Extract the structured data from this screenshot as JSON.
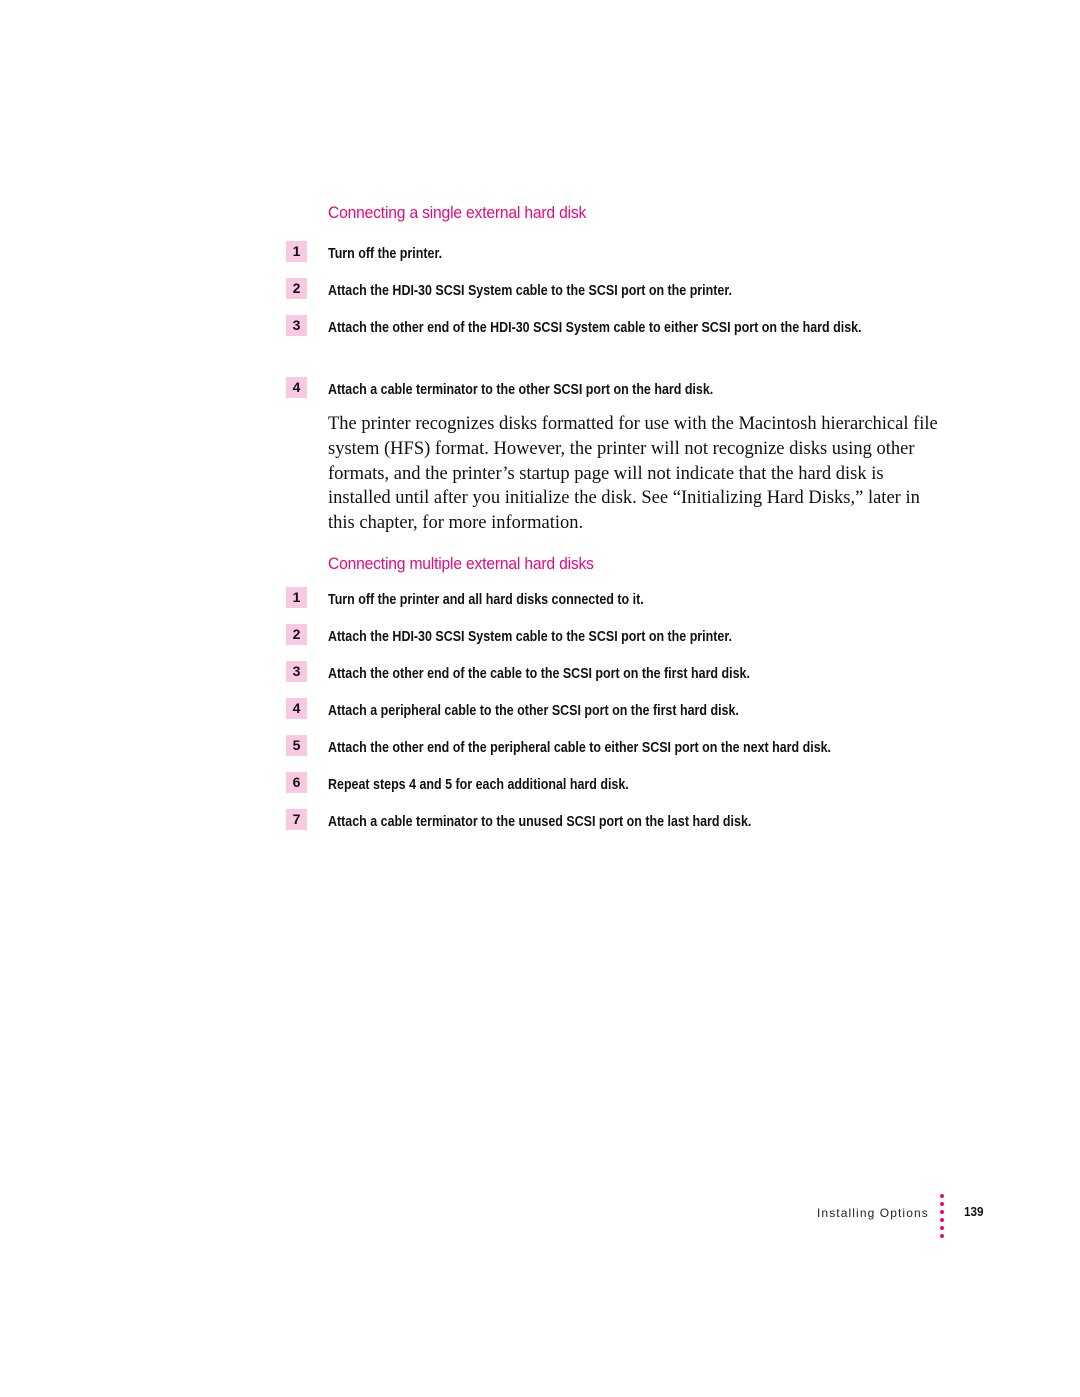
{
  "sections": [
    {
      "heading": "Connecting a single external hard disk",
      "steps": [
        {
          "number": "1",
          "text": "Turn off the printer."
        },
        {
          "number": "2",
          "text": "Attach the HDI-30 SCSI System cable to the SCSI port on the printer."
        },
        {
          "number": "3",
          "text": "Attach the other end of the HDI-30 SCSI System cable to either SCSI port on the hard disk."
        },
        {
          "number": "4",
          "text": "Attach a cable terminator to the other SCSI port on the hard disk."
        }
      ],
      "paragraph": "The printer recognizes disks formatted for use with the Macintosh hierarchical file system (HFS) format. However, the printer will not recognize disks using other formats, and the printer’s startup page will not indicate that the hard disk is installed until after you initialize the disk. See “Initializing Hard Disks,” later in this chapter, for more information."
    },
    {
      "heading": "Connecting multiple external hard disks",
      "steps": [
        {
          "number": "1",
          "text": "Turn off the printer and all hard disks connected to it."
        },
        {
          "number": "2",
          "text": "Attach the HDI-30 SCSI System cable to the SCSI port on the printer."
        },
        {
          "number": "3",
          "text": "Attach the other end of the cable to the SCSI port on the first hard disk."
        },
        {
          "number": "4",
          "text": "Attach a peripheral cable to the other SCSI port on the first hard disk."
        },
        {
          "number": "5",
          "text": "Attach the other end of the peripheral cable to either SCSI port on the next hard disk."
        },
        {
          "number": "6",
          "text": "Repeat steps 4 and 5 for each additional hard disk."
        },
        {
          "number": "7",
          "text": "Attach a cable terminator to the unused SCSI port on the last hard disk."
        }
      ]
    }
  ],
  "footer": {
    "chapter_title": "Installing Options",
    "page_number": "139"
  },
  "colors": {
    "accent": "#e5097f",
    "badge_bg": "#f9c9e2"
  }
}
